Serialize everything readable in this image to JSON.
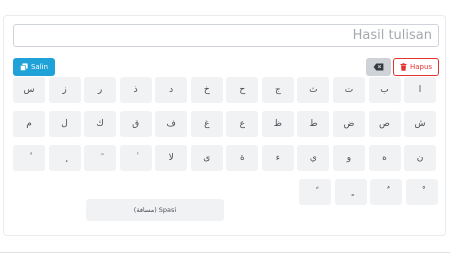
{
  "output": {
    "placeholder": "Hasil tulisan"
  },
  "toolbar": {
    "copy_label": "Salin",
    "delete_label": "Hapus"
  },
  "keyboard": {
    "rows": [
      [
        "س",
        "ز",
        "ر",
        "ذ",
        "د",
        "خ",
        "ح",
        "ج",
        "ث",
        "ت",
        "ب",
        "ا"
      ],
      [
        "م",
        "ل",
        "ك",
        "ق",
        "ف",
        "غ",
        "ع",
        "ظ",
        "ط",
        "ض",
        "ص",
        "ش"
      ],
      [
        "ٔ",
        "ٕ",
        "ٓ",
        "ٰ",
        "لا",
        "ى",
        "ة",
        "ء",
        "ي",
        "و",
        "ه",
        "ن"
      ],
      [
        "ً",
        "ٍ",
        "ٌ",
        "ْ"
      ]
    ],
    "space_label": "(مسافة) Spasi"
  }
}
